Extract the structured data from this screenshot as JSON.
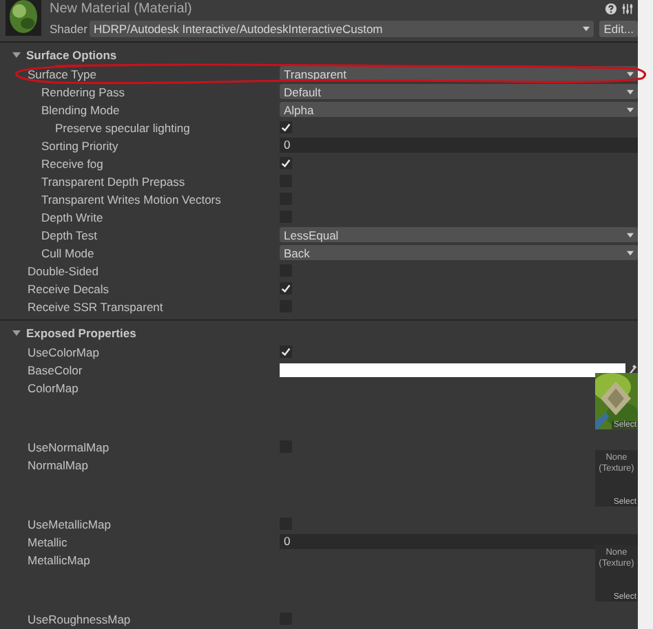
{
  "header": {
    "title": "New Material (Material)",
    "shader_label": "Shader",
    "shader": "HDRP/Autodesk Interactive/AutodeskInteractiveCustom",
    "edit_button": "Edit..."
  },
  "sections": [
    {
      "title": "Surface Options",
      "expanded": true,
      "properties": [
        {
          "label": "Surface Type",
          "kind": "dropdown",
          "value": "Transparent",
          "children": [
            {
              "label": "Rendering Pass",
              "kind": "dropdown",
              "value": "Default"
            },
            {
              "label": "Blending Mode",
              "kind": "dropdown",
              "value": "Alpha",
              "children": [
                {
                  "label": "Preserve specular lighting",
                  "kind": "checkbox",
                  "checked": true
                }
              ]
            },
            {
              "label": "Sorting Priority",
              "kind": "number",
              "value": "0"
            },
            {
              "label": "Receive fog",
              "kind": "checkbox",
              "checked": true
            },
            {
              "label": "Transparent Depth Prepass",
              "kind": "checkbox",
              "checked": false
            },
            {
              "label": "Transparent Writes Motion Vectors",
              "kind": "checkbox",
              "checked": false
            },
            {
              "label": "Depth Write",
              "kind": "checkbox",
              "checked": false
            },
            {
              "label": "Depth Test",
              "kind": "dropdown",
              "value": "LessEqual"
            },
            {
              "label": "Cull Mode",
              "kind": "dropdown",
              "value": "Back"
            }
          ]
        },
        {
          "label": "Double-Sided",
          "kind": "checkbox",
          "checked": false
        },
        {
          "label": "Receive Decals",
          "kind": "checkbox",
          "checked": true
        },
        {
          "label": "Receive SSR Transparent",
          "kind": "checkbox",
          "checked": false
        }
      ]
    },
    {
      "title": "Exposed Properties",
      "expanded": true,
      "properties": [
        {
          "label": "UseColorMap",
          "kind": "checkbox",
          "checked": true
        },
        {
          "label": "BaseColor",
          "kind": "color",
          "color": "#ffffff"
        },
        {
          "label": "ColorMap",
          "kind": "texture",
          "button": "Select"
        },
        {
          "label": "UseNormalMap",
          "kind": "checkbox",
          "checked": false
        },
        {
          "label": "NormalMap",
          "kind": "texture",
          "texture": {
            "name": "None (Texture)"
          },
          "button": "Select"
        },
        {
          "label": "UseMetallicMap",
          "kind": "checkbox",
          "checked": false
        },
        {
          "label": "Metallic",
          "kind": "number",
          "value": "0"
        },
        {
          "label": "MetallicMap",
          "kind": "texture",
          "texture": {
            "name": "None (Texture)"
          },
          "button": "Select"
        },
        {
          "label": "UseRoughnessMap",
          "kind": "checkbox",
          "checked": false
        }
      ]
    }
  ]
}
